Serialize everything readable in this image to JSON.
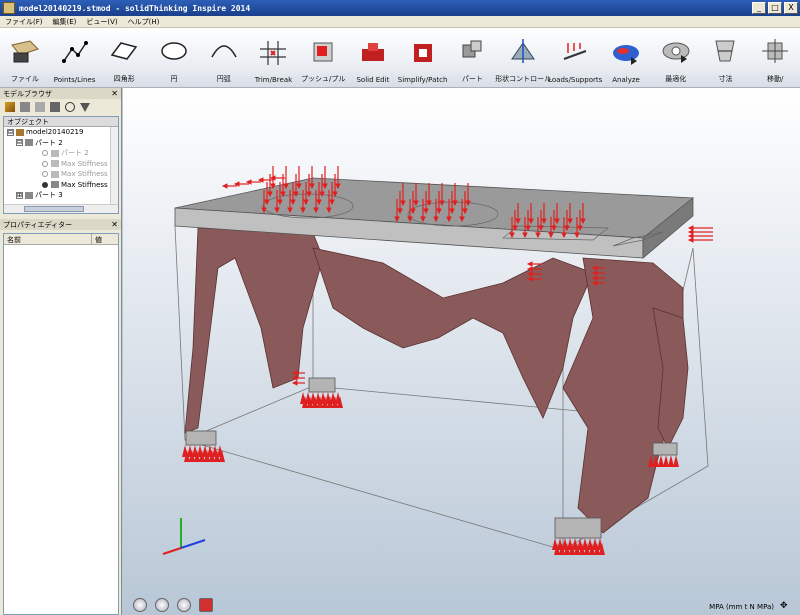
{
  "window": {
    "title": "model20140219.stmod - solidThinking Inspire 2014",
    "minimize": "_",
    "maximize": "□",
    "close": "X"
  },
  "menu": [
    "ファイル(F)",
    "編集(E)",
    "ビュー(V)",
    "ヘルプ(H)"
  ],
  "toolbar": [
    {
      "label": "ファイル",
      "icon": "file-folder-icon"
    },
    {
      "label": "Points/Lines",
      "icon": "points-lines-icon"
    },
    {
      "label": "四角形",
      "icon": "rectangle-icon"
    },
    {
      "label": "円",
      "icon": "circle-icon"
    },
    {
      "label": "円弧",
      "icon": "arc-icon"
    },
    {
      "label": "Trim/Break",
      "icon": "trim-break-icon"
    },
    {
      "label": "プッシュ/プル",
      "icon": "push-pull-icon"
    },
    {
      "label": "Solid Edit",
      "icon": "solid-edit-icon"
    },
    {
      "label": "Simplify/Patch",
      "icon": "simplify-patch-icon"
    },
    {
      "label": "パート",
      "icon": "part-icon"
    },
    {
      "label": "形状コントロール",
      "icon": "shape-control-icon"
    },
    {
      "label": "Loads/Supports",
      "icon": "loads-supports-icon"
    },
    {
      "label": "Analyze",
      "icon": "analyze-icon"
    },
    {
      "label": "最適化",
      "icon": "optimize-icon"
    },
    {
      "label": "寸法",
      "icon": "dimension-icon"
    },
    {
      "label": "移動/",
      "icon": "move-icon"
    }
  ],
  "model_browser": {
    "title": "モデルブラウザ",
    "tab": "オブジェクト",
    "tree": [
      {
        "label": "model20140219",
        "level": 0,
        "expander": "⊟",
        "dim": false
      },
      {
        "label": "パート 2",
        "level": 1,
        "expander": "⊟",
        "dim": false
      },
      {
        "label": "パート 2",
        "level": 2,
        "radio": "off",
        "dim": true
      },
      {
        "label": "Max Stiffness",
        "level": 2,
        "radio": "off",
        "dim": true
      },
      {
        "label": "Max Stiffness",
        "level": 2,
        "radio": "off",
        "dim": true
      },
      {
        "label": "Max Stiffness",
        "level": 2,
        "radio": "on",
        "dim": false
      },
      {
        "label": "パート 3",
        "level": 1,
        "expander": "⊞",
        "dim": false
      }
    ]
  },
  "property_editor": {
    "title": "プロパティエディター",
    "col_name": "名前",
    "col_value": "値"
  },
  "viewport": {
    "status_units": "MPA (mm t N MPa)",
    "colors": {
      "plate": "#8a8a8a",
      "structure": "#8a5a5a",
      "load_arrow": "#e02020"
    }
  }
}
